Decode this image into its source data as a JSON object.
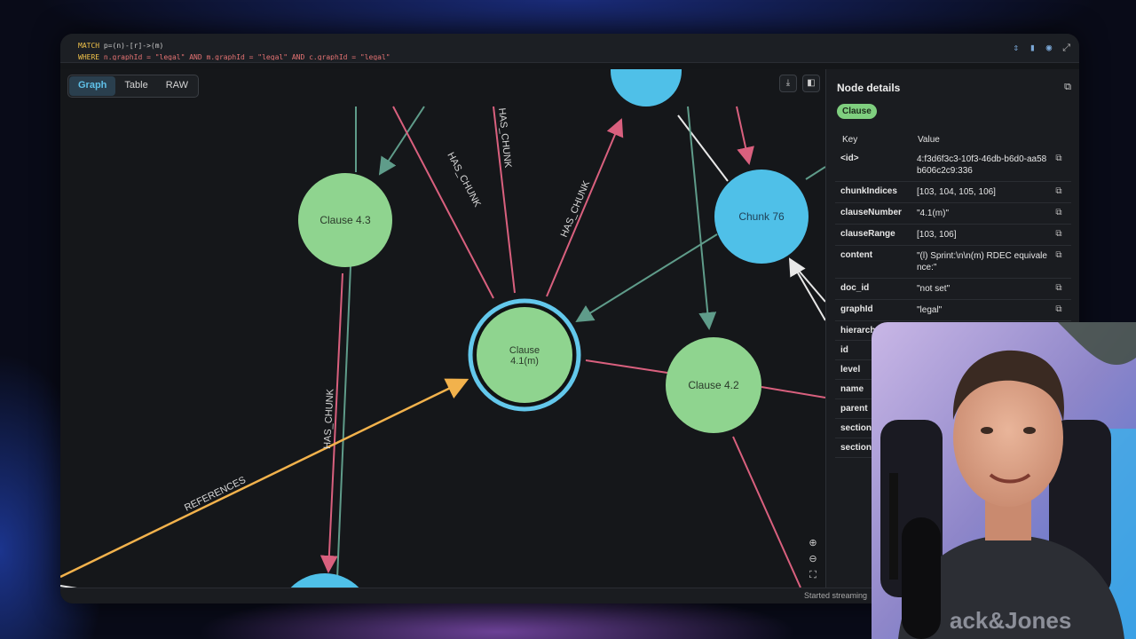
{
  "query": {
    "line1_kw": "MATCH",
    "line1_rest": " p=(n)-[r]->(m)",
    "line2_kw": "WHERE",
    "line2_rest": " n.graphId = \"legal\" AND m.graphId = \"legal\" AND c.graphId = \"legal\""
  },
  "view_tabs": [
    "Graph",
    "Table",
    "RAW"
  ],
  "graph": {
    "nodes": {
      "clause_43": "Clause 4.3",
      "clause_41m_line1": "Clause",
      "clause_41m_line2": "4.1(m)",
      "clause_42": "Clause 4.2",
      "chunk_76": "Chunk 76"
    },
    "edge_labels": {
      "has_chunk_a": "HAS_CHUNK",
      "has_chunk_b": "HAS_CHUNK",
      "has_chunk_c": "HAS_CHUNK",
      "has_chunk_d": "HAS_CHUNK",
      "references": "REFERENCES"
    },
    "colors": {
      "clause": "#8fd48f",
      "chunk": "#4fc0e8",
      "has_chunk_edge": "#d9607e",
      "child_edge": "#5f9c8a",
      "references_edge": "#f2b24c",
      "other_edge": "#e8e8e8"
    }
  },
  "panel": {
    "title": "Node details",
    "label_chip": "Clause",
    "key_header": "Key",
    "value_header": "Value",
    "properties": [
      {
        "key": "<id>",
        "value": "4:f3d6f3c3-10f3-46db-b6d0-aa58b606c2c9:336"
      },
      {
        "key": "chunkIndices",
        "value": "[103, 104, 105, 106]"
      },
      {
        "key": "clauseNumber",
        "value": "\"4.1(m)\""
      },
      {
        "key": "clauseRange",
        "value": "[103, 106]"
      },
      {
        "key": "content",
        "value": "\"(l) Sprint:\\n\\n(m) RDEC equivalence:\""
      },
      {
        "key": "doc_id",
        "value": "\"not set\""
      },
      {
        "key": "graphId",
        "value": "\"legal\""
      },
      {
        "key": "hierarchyPath",
        "value": ""
      },
      {
        "key": "id",
        "value": ""
      },
      {
        "key": "level",
        "value": ""
      },
      {
        "key": "name",
        "value": ""
      },
      {
        "key": "parent",
        "value": ""
      },
      {
        "key": "section",
        "value": ""
      },
      {
        "key": "section",
        "value": ""
      }
    ]
  },
  "status": "Started streaming",
  "icons": {
    "copy": "copy-icon",
    "download": "download-icon",
    "sidebar": "sidebar-toggle-icon",
    "zoom_in": "zoom-in-icon",
    "zoom_out": "zoom-out-icon",
    "fit": "fit-view-icon"
  }
}
